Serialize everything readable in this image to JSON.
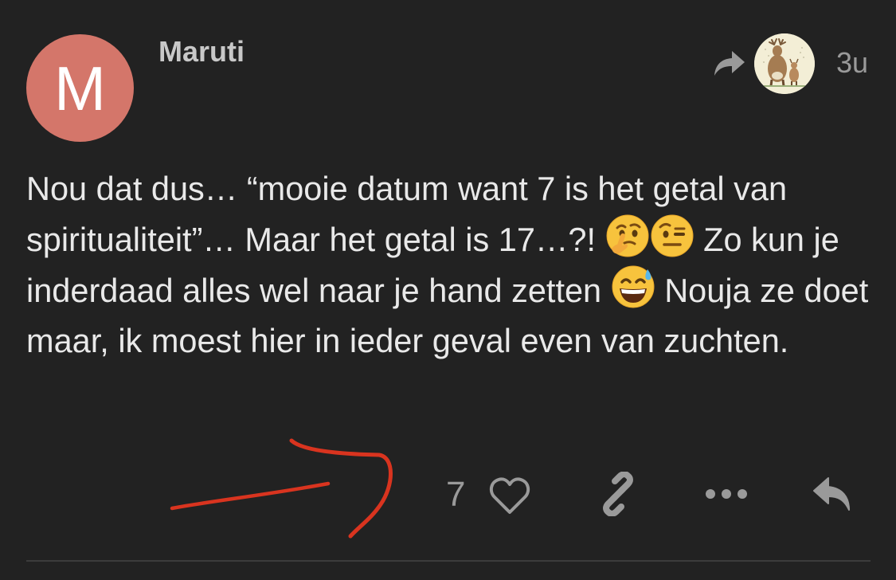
{
  "post": {
    "avatar_letter": "M",
    "username": "Maruti",
    "timestamp": "3u",
    "body_segments": [
      "Nou dat dus… “mooie datum want 7 is het getal van spiritualiteit”… Maar het getal is 17…?! ",
      " Zo kun je inderdaad alles wel naar je hand zetten ",
      " Nouja ze doet maar, ik moest hier in ieder geval even van zuchten."
    ],
    "like_count": "7"
  },
  "colors": {
    "background": "#222222",
    "avatar": "#d4766a",
    "text": "#e9e9e9",
    "muted": "#9a9a9a",
    "scribble": "#d9341f"
  },
  "icons": {
    "share": "share-arrow-icon",
    "reply_to_avatar": "deer-avatar",
    "heart": "heart-icon",
    "link": "link-icon",
    "more": "more-dots-icon",
    "reply": "reply-icon",
    "emoji_1": "thinking-face-emoji",
    "emoji_2": "raised-eyebrow-emoji",
    "emoji_3": "grinning-sweat-emoji"
  }
}
